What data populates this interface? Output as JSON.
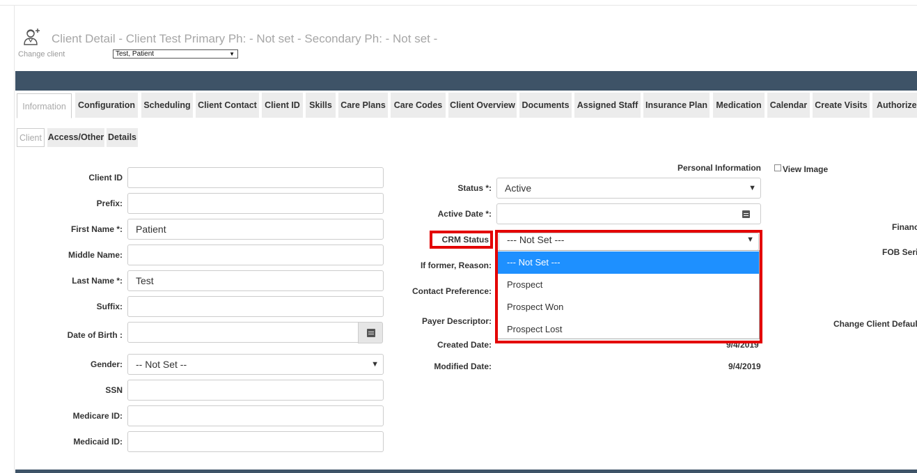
{
  "header": {
    "title": "Client Detail - Client Test Primary Ph: - Not set - Secondary Ph: - Not set -",
    "change_client_label": "Change client",
    "client_selected": "Test, Patient",
    "client_icon": "client-add-icon"
  },
  "tabs": [
    "Information",
    "Configuration",
    "Scheduling",
    "Client Contact",
    "Client ID",
    "Skills",
    "Care Plans",
    "Care Codes",
    "Client Overview",
    "Documents",
    "Assigned Staff",
    "Insurance Plan",
    "Medication",
    "Calendar",
    "Create Visits",
    "Authorize"
  ],
  "active_tab": "Information",
  "subtabs": [
    "Client",
    "Access/Other",
    "Details"
  ],
  "active_subtab": "Client",
  "left_form": {
    "client_id_label": "Client ID",
    "client_id_value": "",
    "prefix_label": "Prefix:",
    "prefix_value": "",
    "first_name_label": "First Name *:",
    "first_name_value": "Patient",
    "middle_name_label": "Middle Name:",
    "middle_name_value": "",
    "last_name_label": "Last Name *:",
    "last_name_value": "Test",
    "suffix_label": "Suffix:",
    "suffix_value": "",
    "dob_label": "Date of Birth :",
    "dob_value": "",
    "gender_label": "Gender:",
    "gender_value": "-- Not Set --",
    "ssn_label": "SSN",
    "ssn_value": "",
    "medicare_label": "Medicare ID:",
    "medicare_value": "",
    "medicaid_label": "Medicaid ID:",
    "medicaid_value": ""
  },
  "middle_form": {
    "section_title": "Personal Information",
    "status_label": "Status *:",
    "status_value": "Active",
    "active_date_label": "Active Date *:",
    "active_date_value": "",
    "crm_status_label": "CRM Status",
    "crm_status_value": "--- Not Set ---",
    "crm_options": [
      "--- Not Set ---",
      "Prospect",
      "Prospect Won",
      "Prospect Lost"
    ],
    "if_former_label": "If former, Reason:",
    "contact_pref_label": "Contact Preference:",
    "payer_descriptor_label": "Payer Descriptor:",
    "created_date_label": "Created Date:",
    "created_date_value": "9/4/2019",
    "modified_date_label": "Modified Date:",
    "modified_date_value": "9/4/2019"
  },
  "right_panel": {
    "view_image_label": "View Image",
    "finance_label": "Financ",
    "fob_label": "FOB Seri",
    "change_default_label": "Change Client Defaul"
  },
  "colors": {
    "band": "#3e5367",
    "highlight": "#e30000",
    "selected_option": "#1e90ff"
  }
}
